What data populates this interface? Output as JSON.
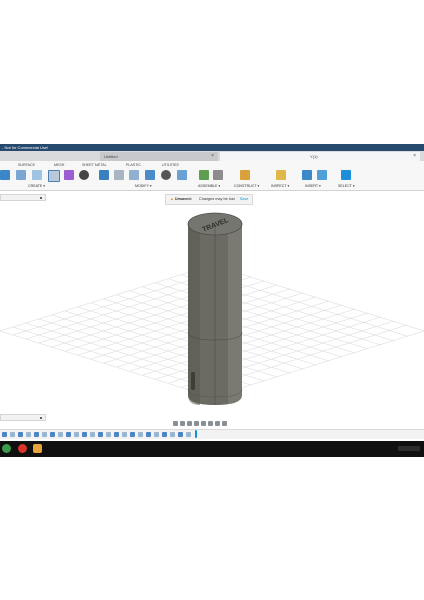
{
  "app": {
    "title": "- Not for Commercial Use!"
  },
  "tabs": {
    "inactive": "Untitled",
    "active": "Y(1)"
  },
  "workspace_tabs": [
    "SURFACE",
    "MESH",
    "SHEET METAL",
    "PLASTIC",
    "UTILITIES"
  ],
  "groups": [
    "CREATE ▾",
    "MODIFY ▾",
    "ASSEMBLE ▾",
    "CONSTRUCT ▾",
    "INSPECT ▾",
    "INSERT ▾",
    "SELECT ▾"
  ],
  "notice": {
    "warning_icon": "warning-icon",
    "label": "Unsaved:",
    "message": "Changes may be lost",
    "save": "Save"
  },
  "model": {
    "engraving": "TRAVEL"
  },
  "colors": {
    "accent": "#0696d7",
    "titlebar": "#27496d",
    "model": "#6b6b63"
  }
}
